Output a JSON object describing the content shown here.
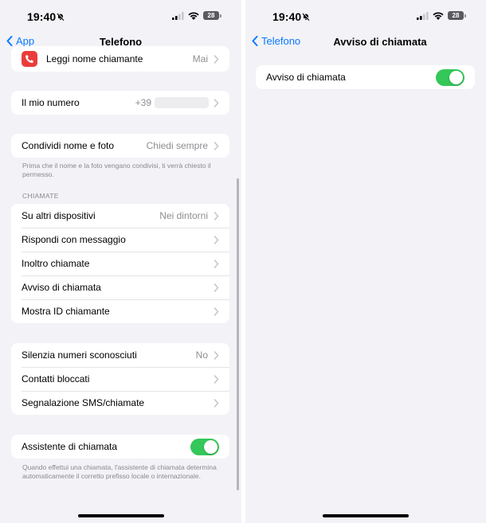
{
  "left_screen": {
    "status": {
      "time": "19:40",
      "battery": "28"
    },
    "nav": {
      "back_label": "App",
      "title": "Telefono"
    },
    "top_group": {
      "label": "Leggi nome chiamante",
      "value": "Mai"
    },
    "number_group": {
      "label": "Il mio numero",
      "value": "+39"
    },
    "share_group": {
      "label": "Condividi nome e foto",
      "value": "Chiedi sempre",
      "footnote": "Prima che il nome e la foto vengano condivisi, ti verrà chiesto il permesso."
    },
    "calls_section": {
      "header": "CHIAMATE",
      "items": [
        {
          "label": "Su altri dispositivi",
          "value": "Nei dintorni"
        },
        {
          "label": "Rispondi con messaggio",
          "value": ""
        },
        {
          "label": "Inoltro chiamate",
          "value": ""
        },
        {
          "label": "Avviso di chiamata",
          "value": ""
        },
        {
          "label": "Mostra ID chiamante",
          "value": ""
        }
      ]
    },
    "silence_group": {
      "items": [
        {
          "label": "Silenzia numeri sconosciuti",
          "value": "No"
        },
        {
          "label": "Contatti bloccati",
          "value": ""
        },
        {
          "label": "Segnalazione SMS/chiamate",
          "value": ""
        }
      ]
    },
    "assist_group": {
      "label": "Assistente di chiamata",
      "toggle_on": true,
      "footnote": "Quando effettui una chiamata, l'assistente di chiamata determina automaticamente il corretto prefisso locale o internazionale."
    }
  },
  "right_screen": {
    "status": {
      "time": "19:40",
      "battery": "28"
    },
    "nav": {
      "back_label": "Telefono",
      "title": "Avviso di chiamata"
    },
    "setting": {
      "label": "Avviso di chiamata",
      "toggle_on": true
    }
  },
  "colors": {
    "accent": "#0a7aff",
    "toggle_on": "#34c759",
    "background": "#f2f2f7",
    "secondary_text": "#8e8e93",
    "app_icon": "#ea3d3b"
  },
  "icons": {
    "back": "chevron-left-icon",
    "disclosure": "chevron-right-icon",
    "silent": "bell-slash-icon",
    "signal": "cellular-signal-icon",
    "wifi": "wifi-icon",
    "battery": "battery-icon",
    "app": "phone-app-icon"
  }
}
